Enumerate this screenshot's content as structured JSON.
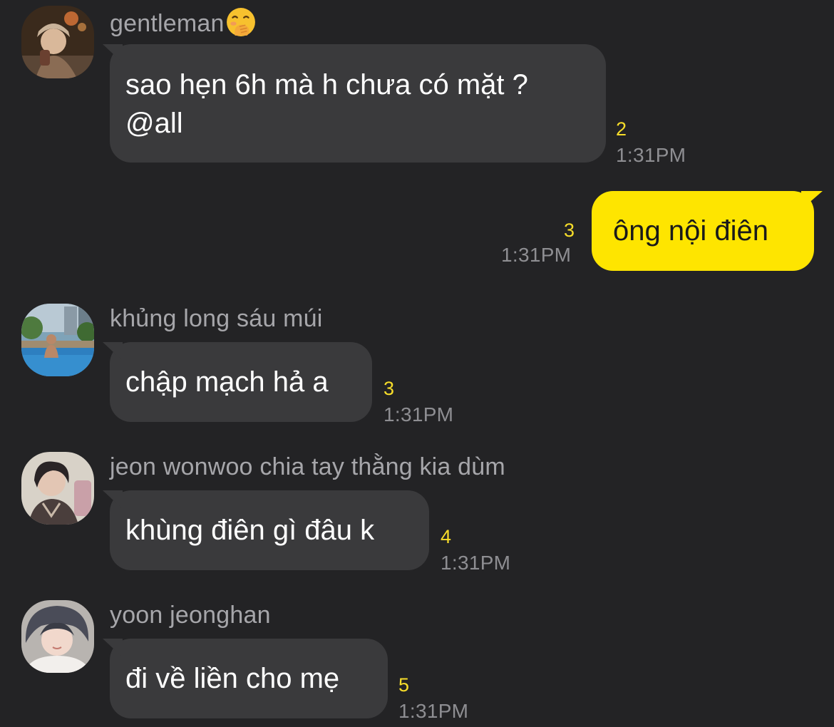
{
  "messages": [
    {
      "sender": "gentleman",
      "sender_emoji": "face-with-hand-over-mouth-icon",
      "text_lines": [
        "sao hẹn 6h mà h chưa có mặt ?",
        "@all"
      ],
      "unread": "2",
      "time": "1:31PM",
      "direction": "incoming"
    },
    {
      "text_lines": [
        "ông nội điên"
      ],
      "unread": "3",
      "time": "1:31PM",
      "direction": "outgoing"
    },
    {
      "sender": "khủng long sáu múi",
      "text_lines": [
        "chập mạch hả a"
      ],
      "unread": "3",
      "time": "1:31PM",
      "direction": "incoming"
    },
    {
      "sender": "jeon wonwoo chia tay thằng kia dùm",
      "text_lines": [
        "khùng điên gì đâu k"
      ],
      "unread": "4",
      "time": "1:31PM",
      "direction": "incoming"
    },
    {
      "sender": "yoon jeonghan",
      "text_lines": [
        "đi về liền cho mẹ"
      ],
      "unread": "5",
      "time": "1:31PM",
      "direction": "incoming"
    }
  ],
  "colors": {
    "background": "#232325",
    "incoming_bubble": "#3a3a3c",
    "outgoing_bubble": "#fee500",
    "unread_count": "#f7dd2a",
    "timestamp": "#8e8e92",
    "sender_name": "#a6a6aa"
  }
}
